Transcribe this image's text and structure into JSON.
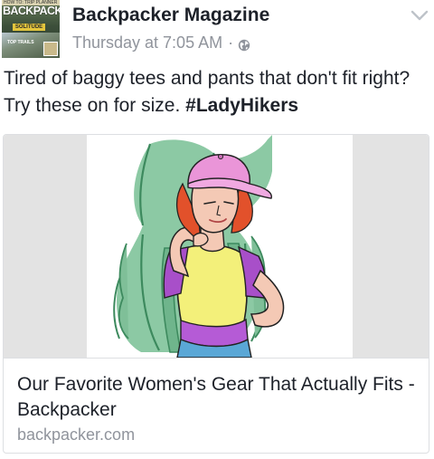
{
  "post": {
    "page_name": "Backpacker Magazine",
    "timestamp": "Thursday at 7:05 AM",
    "separator": "·",
    "privacy_icon": "globe-icon",
    "menu_icon": "chevron-down-icon",
    "avatar": {
      "masthead": "BACKPACKER",
      "top_line": "HOW TO: TRIP PLANNER",
      "cover_line": "SOLITUDE",
      "cover_text": "TOP TRAILS"
    },
    "text": "Tired of baggy tees and pants that don't fit right? Try these on for size. ",
    "hashtag": "#LadyHikers"
  },
  "link_card": {
    "image_icon": "woman-hiker-illustration",
    "title": "Our Favorite Women's Gear That Actually Fits - Backpacker",
    "domain": "backpacker.com"
  },
  "colors": {
    "text": "#1d2129",
    "secondary": "#90949c",
    "border": "#dddfe2",
    "card_side": "#e3e3e3"
  }
}
